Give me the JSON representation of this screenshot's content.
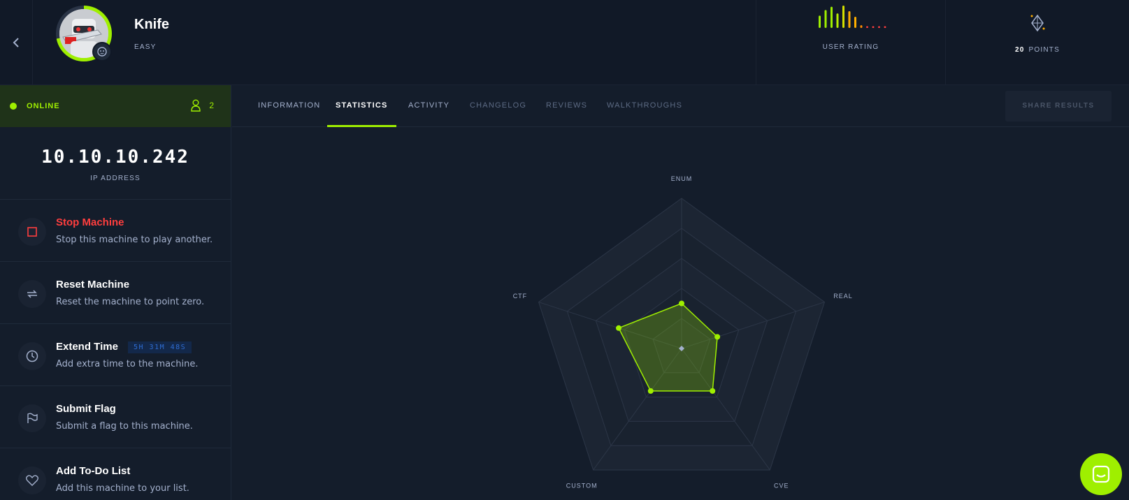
{
  "header": {
    "back_icon": "chevron-left-icon",
    "machine": {
      "name": "Knife",
      "difficulty": "EASY",
      "avatar_icon": "robot-avatar",
      "os_badge_icon": "linux-penguin-icon"
    },
    "rating": {
      "label": "USER RATING",
      "bar_heights": [
        0.55,
        0.8,
        0.95,
        0.65,
        1.0,
        0.75,
        0.5,
        0.12,
        0.08,
        0.08,
        0.08,
        0.08
      ],
      "bar_colors": [
        "#9fef00",
        "#9fef00",
        "#9fef00",
        "#b8ef00",
        "#d4e000",
        "#ffaf00",
        "#ffaf00",
        "#ff8c00",
        "#ff3e3e",
        "#ff3e3e",
        "#ff3e3e",
        "#ff3e3e"
      ]
    },
    "points": {
      "value": "20",
      "label": "POINTS",
      "icon": "diamond-points-icon"
    }
  },
  "sidebar": {
    "status": {
      "label": "ONLINE",
      "players": "2",
      "player_icon": "user-icon"
    },
    "ip": {
      "value": "10.10.10.242",
      "label": "IP ADDRESS"
    },
    "actions": [
      {
        "title": "Stop Machine",
        "desc": "Stop this machine to play another.",
        "icon": "stop-icon"
      },
      {
        "title": "Reset Machine",
        "desc": "Reset the machine to point zero.",
        "icon": "reset-icon"
      },
      {
        "title": "Extend Time",
        "desc": "Add extra time to the machine.",
        "icon": "clock-icon",
        "timer": "5H 31M 48S"
      },
      {
        "title": "Submit Flag",
        "desc": "Submit a flag to this machine.",
        "icon": "flag-icon"
      },
      {
        "title": "Add To-Do List",
        "desc": "Add this machine to your list.",
        "icon": "heart-icon"
      }
    ]
  },
  "tabs": [
    {
      "label": "INFORMATION",
      "state": "inactive"
    },
    {
      "label": "STATISTICS",
      "state": "active"
    },
    {
      "label": "ACTIVITY",
      "state": "inactive"
    },
    {
      "label": "CHANGELOG",
      "state": "disabled"
    },
    {
      "label": "REVIEWS",
      "state": "disabled"
    },
    {
      "label": "WALKTHROUGHS",
      "state": "disabled"
    }
  ],
  "share_label": "SHARE RESULTS",
  "colors": {
    "accent": "#9fef00",
    "danger": "#ff3e3e",
    "bg": "#141d2b",
    "panel": "#111927"
  },
  "chart_data": {
    "type": "radar",
    "axes": [
      "ENUM",
      "REAL",
      "CVE",
      "CUSTOM",
      "CTF"
    ],
    "rings": 5,
    "series": [
      {
        "values": [
          0.3,
          0.25,
          0.35,
          0.35,
          0.44
        ]
      }
    ],
    "color": "#9fef00"
  },
  "chat_icon": "chat-bubble-icon"
}
